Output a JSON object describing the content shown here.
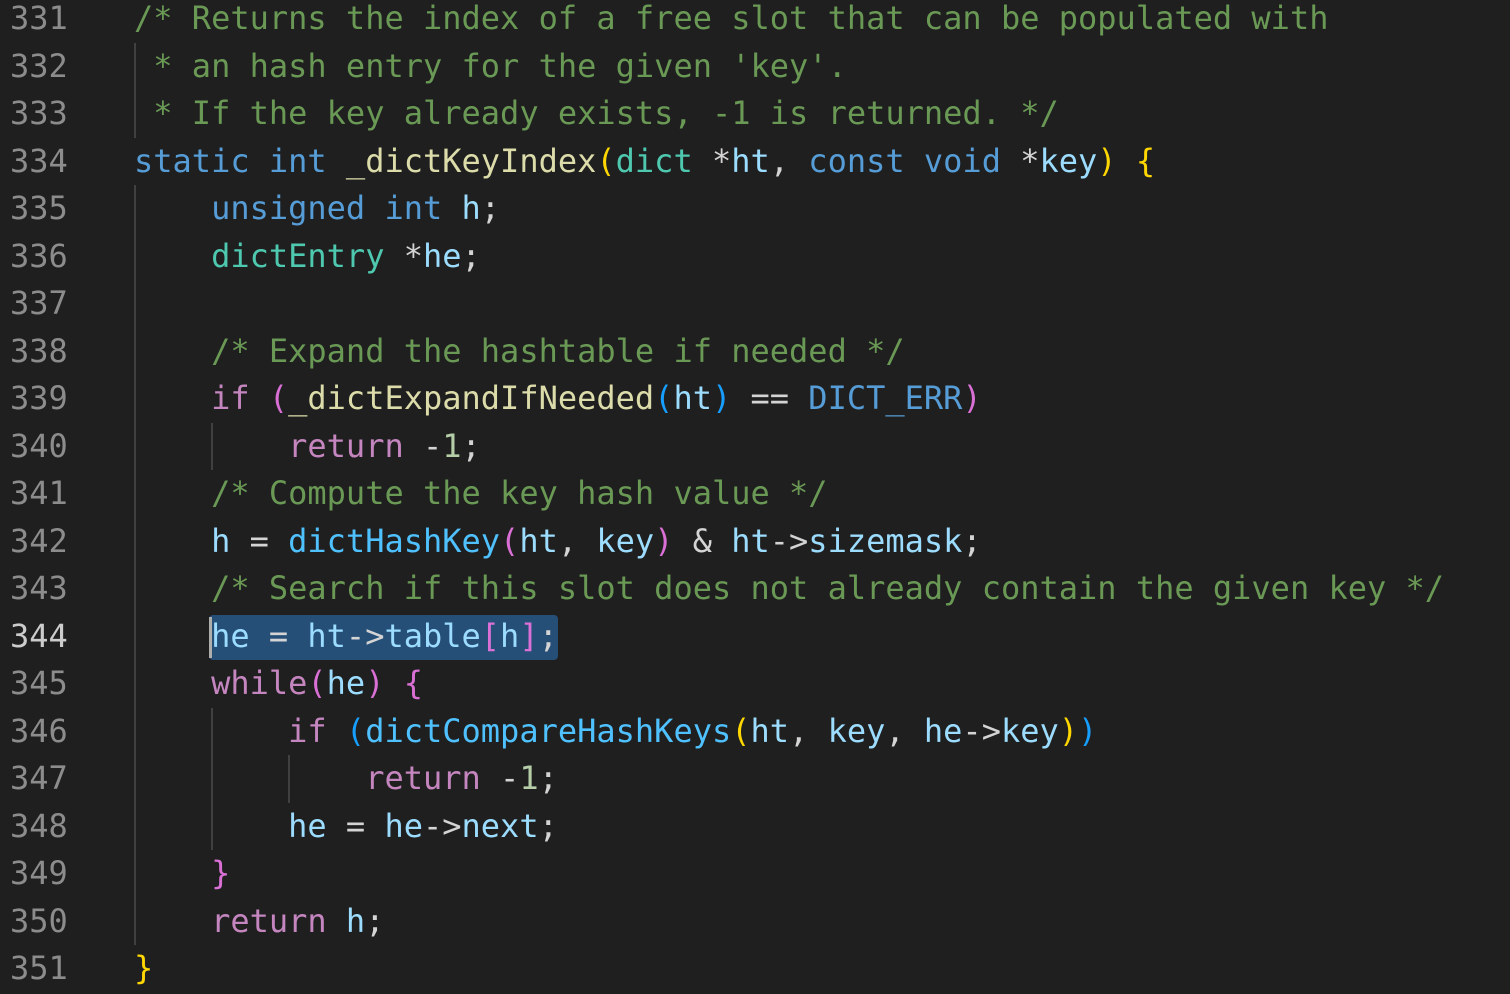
{
  "editor": {
    "active_line": 344,
    "colors": {
      "background": "#1f1f1f",
      "line_number": "#8c8c8c",
      "line_number_active": "#cccccc",
      "comment": "#6a9955",
      "keyword": "#569cd6",
      "control": "#c586c0",
      "type": "#4ec9b0",
      "function": "#dcdcaa",
      "function_call": "#4fc1ff",
      "variable": "#9cdcfe",
      "number": "#b5cea8",
      "selection": "#264f78"
    },
    "lines": [
      {
        "number": "331",
        "tokens": [
          {
            "text": "/* Returns the index of a free slot that can be populated with",
            "cls": "comment"
          }
        ]
      },
      {
        "number": "332",
        "tokens": [
          {
            "text": " * an hash entry for the given 'key'.",
            "cls": "comment"
          }
        ]
      },
      {
        "number": "333",
        "tokens": [
          {
            "text": " * If the key already exists, -1 is returned. */",
            "cls": "comment"
          }
        ]
      },
      {
        "number": "334",
        "tokens": [
          {
            "text": "static",
            "cls": "keyword"
          },
          {
            "text": " ",
            "cls": "plain"
          },
          {
            "text": "int",
            "cls": "keyword"
          },
          {
            "text": " ",
            "cls": "plain"
          },
          {
            "text": "_dictKeyIndex",
            "cls": "fn"
          },
          {
            "text": "(",
            "cls": "b1"
          },
          {
            "text": "dict",
            "cls": "type"
          },
          {
            "text": " *",
            "cls": "plain"
          },
          {
            "text": "ht",
            "cls": "var"
          },
          {
            "text": ", ",
            "cls": "plain"
          },
          {
            "text": "const",
            "cls": "keyword"
          },
          {
            "text": " ",
            "cls": "plain"
          },
          {
            "text": "void",
            "cls": "keyword"
          },
          {
            "text": " *",
            "cls": "plain"
          },
          {
            "text": "key",
            "cls": "var"
          },
          {
            "text": ")",
            "cls": "b1"
          },
          {
            "text": " ",
            "cls": "plain"
          },
          {
            "text": "{",
            "cls": "b1"
          }
        ]
      },
      {
        "number": "335",
        "tokens": [
          {
            "text": "    ",
            "cls": "plain"
          },
          {
            "text": "unsigned",
            "cls": "keyword"
          },
          {
            "text": " ",
            "cls": "plain"
          },
          {
            "text": "int",
            "cls": "keyword"
          },
          {
            "text": " ",
            "cls": "plain"
          },
          {
            "text": "h",
            "cls": "var"
          },
          {
            "text": ";",
            "cls": "plain"
          }
        ]
      },
      {
        "number": "336",
        "tokens": [
          {
            "text": "    ",
            "cls": "plain"
          },
          {
            "text": "dictEntry",
            "cls": "type"
          },
          {
            "text": " *",
            "cls": "plain"
          },
          {
            "text": "he",
            "cls": "var"
          },
          {
            "text": ";",
            "cls": "plain"
          }
        ]
      },
      {
        "number": "337",
        "tokens": []
      },
      {
        "number": "338",
        "tokens": [
          {
            "text": "    ",
            "cls": "plain"
          },
          {
            "text": "/* Expand the hashtable if needed */",
            "cls": "comment"
          }
        ]
      },
      {
        "number": "339",
        "tokens": [
          {
            "text": "    ",
            "cls": "plain"
          },
          {
            "text": "if",
            "cls": "control"
          },
          {
            "text": " ",
            "cls": "plain"
          },
          {
            "text": "(",
            "cls": "b2"
          },
          {
            "text": "_dictExpandIfNeeded",
            "cls": "fn"
          },
          {
            "text": "(",
            "cls": "b3"
          },
          {
            "text": "ht",
            "cls": "var"
          },
          {
            "text": ")",
            "cls": "b3"
          },
          {
            "text": " == ",
            "cls": "plain"
          },
          {
            "text": "DICT_ERR",
            "cls": "keyword"
          },
          {
            "text": ")",
            "cls": "b2"
          }
        ]
      },
      {
        "number": "340",
        "tokens": [
          {
            "text": "        ",
            "cls": "plain"
          },
          {
            "text": "return",
            "cls": "control"
          },
          {
            "text": " -",
            "cls": "plain"
          },
          {
            "text": "1",
            "cls": "num"
          },
          {
            "text": ";",
            "cls": "plain"
          }
        ]
      },
      {
        "number": "341",
        "tokens": [
          {
            "text": "    ",
            "cls": "plain"
          },
          {
            "text": "/* Compute the key hash value */",
            "cls": "comment"
          }
        ]
      },
      {
        "number": "342",
        "tokens": [
          {
            "text": "    ",
            "cls": "plain"
          },
          {
            "text": "h",
            "cls": "var"
          },
          {
            "text": " = ",
            "cls": "plain"
          },
          {
            "text": "dictHashKey",
            "cls": "fncall"
          },
          {
            "text": "(",
            "cls": "b2"
          },
          {
            "text": "ht",
            "cls": "var"
          },
          {
            "text": ", ",
            "cls": "plain"
          },
          {
            "text": "key",
            "cls": "var"
          },
          {
            "text": ")",
            "cls": "b2"
          },
          {
            "text": " & ",
            "cls": "plain"
          },
          {
            "text": "ht",
            "cls": "var"
          },
          {
            "text": "->",
            "cls": "plain"
          },
          {
            "text": "sizemask",
            "cls": "var"
          },
          {
            "text": ";",
            "cls": "plain"
          }
        ]
      },
      {
        "number": "343",
        "tokens": [
          {
            "text": "    ",
            "cls": "plain"
          },
          {
            "text": "/* Search if this slot does not already contain the given key */",
            "cls": "comment"
          }
        ]
      },
      {
        "number": "344",
        "tokens": [
          {
            "text": "    ",
            "cls": "plain"
          },
          {
            "text": "he",
            "cls": "var"
          },
          {
            "text": " = ",
            "cls": "plain"
          },
          {
            "text": "ht",
            "cls": "var"
          },
          {
            "text": "->",
            "cls": "plain"
          },
          {
            "text": "table",
            "cls": "var"
          },
          {
            "text": "[",
            "cls": "b2"
          },
          {
            "text": "h",
            "cls": "var"
          },
          {
            "text": "]",
            "cls": "b2"
          },
          {
            "text": ";",
            "cls": "plain"
          }
        ]
      },
      {
        "number": "345",
        "tokens": [
          {
            "text": "    ",
            "cls": "plain"
          },
          {
            "text": "while",
            "cls": "control"
          },
          {
            "text": "(",
            "cls": "b2"
          },
          {
            "text": "he",
            "cls": "var"
          },
          {
            "text": ")",
            "cls": "b2"
          },
          {
            "text": " ",
            "cls": "plain"
          },
          {
            "text": "{",
            "cls": "b2"
          }
        ]
      },
      {
        "number": "346",
        "tokens": [
          {
            "text": "        ",
            "cls": "plain"
          },
          {
            "text": "if",
            "cls": "control"
          },
          {
            "text": " ",
            "cls": "plain"
          },
          {
            "text": "(",
            "cls": "b3"
          },
          {
            "text": "dictCompareHashKeys",
            "cls": "fncall"
          },
          {
            "text": "(",
            "cls": "b1"
          },
          {
            "text": "ht",
            "cls": "var"
          },
          {
            "text": ", ",
            "cls": "plain"
          },
          {
            "text": "key",
            "cls": "var"
          },
          {
            "text": ", ",
            "cls": "plain"
          },
          {
            "text": "he",
            "cls": "var"
          },
          {
            "text": "->",
            "cls": "plain"
          },
          {
            "text": "key",
            "cls": "var"
          },
          {
            "text": ")",
            "cls": "b1"
          },
          {
            "text": ")",
            "cls": "b3"
          }
        ]
      },
      {
        "number": "347",
        "tokens": [
          {
            "text": "            ",
            "cls": "plain"
          },
          {
            "text": "return",
            "cls": "control"
          },
          {
            "text": " -",
            "cls": "plain"
          },
          {
            "text": "1",
            "cls": "num"
          },
          {
            "text": ";",
            "cls": "plain"
          }
        ]
      },
      {
        "number": "348",
        "tokens": [
          {
            "text": "        ",
            "cls": "plain"
          },
          {
            "text": "he",
            "cls": "var"
          },
          {
            "text": " = ",
            "cls": "plain"
          },
          {
            "text": "he",
            "cls": "var"
          },
          {
            "text": "->",
            "cls": "plain"
          },
          {
            "text": "next",
            "cls": "var"
          },
          {
            "text": ";",
            "cls": "plain"
          }
        ]
      },
      {
        "number": "349",
        "tokens": [
          {
            "text": "    ",
            "cls": "plain"
          },
          {
            "text": "}",
            "cls": "b2"
          }
        ]
      },
      {
        "number": "350",
        "tokens": [
          {
            "text": "    ",
            "cls": "plain"
          },
          {
            "text": "return",
            "cls": "control"
          },
          {
            "text": " ",
            "cls": "plain"
          },
          {
            "text": "h",
            "cls": "var"
          },
          {
            "text": ";",
            "cls": "plain"
          }
        ]
      },
      {
        "number": "351",
        "tokens": [
          {
            "text": "}",
            "cls": "b1"
          }
        ]
      }
    ]
  }
}
